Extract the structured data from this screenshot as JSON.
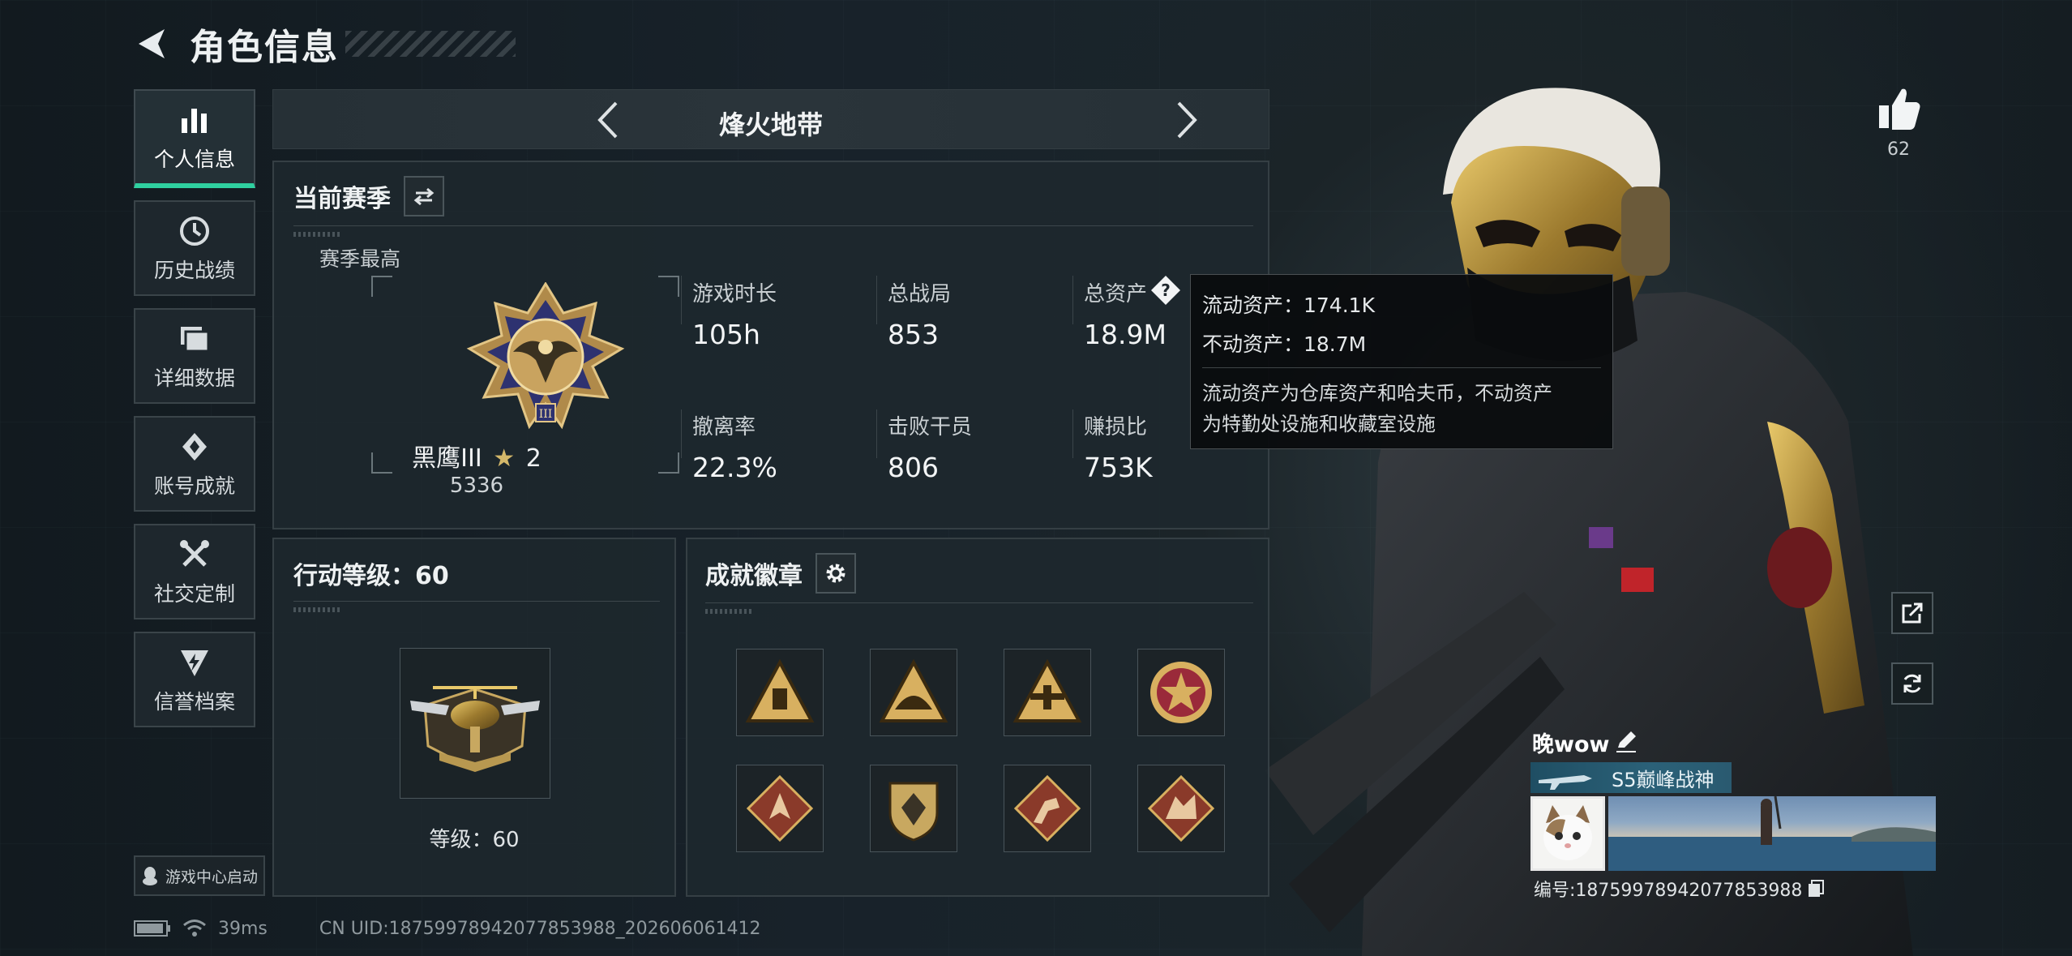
{
  "header": {
    "title": "角色信息"
  },
  "nav": {
    "items": [
      {
        "label": "个人信息",
        "icon": "bar-chart-icon",
        "active": true
      },
      {
        "label": "历史战绩",
        "icon": "clock-icon",
        "active": false
      },
      {
        "label": "详细数据",
        "icon": "folder-icon",
        "active": false
      },
      {
        "label": "账号成就",
        "icon": "achievement-icon",
        "active": false
      },
      {
        "label": "社交定制",
        "icon": "tools-icon",
        "active": false
      },
      {
        "label": "信誉档案",
        "icon": "shield-lightning-icon",
        "active": false
      }
    ],
    "launch_label": "游戏中心启动"
  },
  "mode": {
    "name": "烽火地带"
  },
  "season": {
    "title": "当前赛季",
    "best_label": "赛季最高",
    "rank_name": "黑鹰III",
    "rank_stars": "2",
    "rank_score": "5336",
    "stats": [
      {
        "label": "游戏时长",
        "value": "105h"
      },
      {
        "label": "总战局",
        "value": "853"
      },
      {
        "label": "总资产",
        "value": "18.9M"
      },
      {
        "label": "撤离率",
        "value": "22.3%"
      },
      {
        "label": "击败干员",
        "value": "806"
      },
      {
        "label": "赚损比",
        "value": "753K"
      }
    ]
  },
  "tooltip": {
    "liquid": "流动资产：174.1K",
    "fixed": "不动资产：18.7M",
    "desc_line1": "流动资产为仓库资产和哈夫币，不动资产",
    "desc_line2": "为特勤处设施和收藏室设施"
  },
  "action_level": {
    "title": "行动等级：60",
    "level_text": "等级：60"
  },
  "badges": {
    "title": "成就徽章",
    "items": [
      "badge-1",
      "badge-2",
      "badge-3",
      "badge-4",
      "badge-5",
      "badge-6",
      "badge-7",
      "badge-8"
    ]
  },
  "likes": {
    "count": "62"
  },
  "player": {
    "name": "晚wow",
    "title_tag": "S5巅峰战神",
    "uid_label": "编号:18759978942077853988"
  },
  "status": {
    "ping": "39ms",
    "uid": "CN UID:18759978942077853988_202606061412"
  },
  "colors": {
    "accent": "#2fd0a0",
    "panel_bg": "#1e282e",
    "gold": "#d4b86a",
    "title_tag_blue": "#2b6178"
  }
}
